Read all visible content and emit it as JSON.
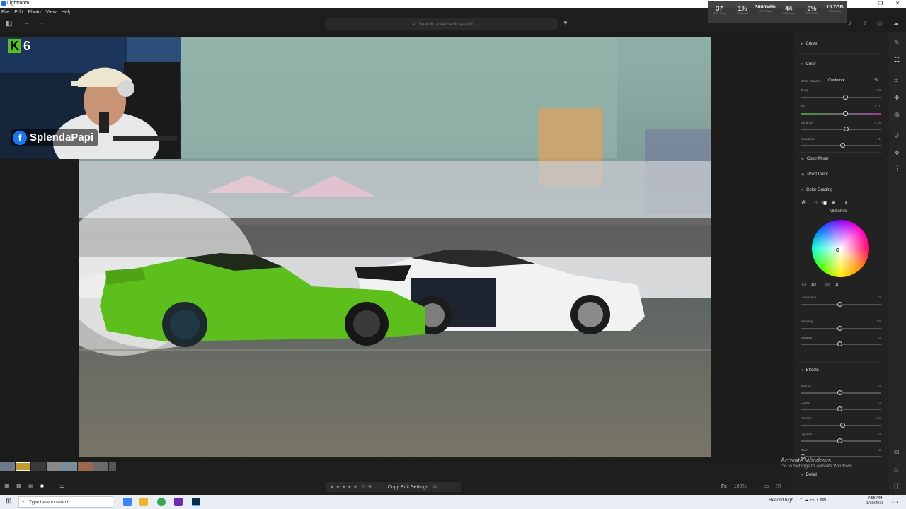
{
  "window": {
    "title": "Lightroom",
    "controls": [
      "—",
      "❐",
      "✕"
    ]
  },
  "menu": [
    "File",
    "Edit",
    "Photo",
    "View",
    "Help"
  ],
  "stats": [
    {
      "value": "37",
      "label": "CPU Temp"
    },
    {
      "value": "1%",
      "label": "GPU Load"
    },
    {
      "value": "3600MHz",
      "label": "CPU Clock"
    },
    {
      "value": "44",
      "label": "GPU Temp"
    },
    {
      "value": "0%",
      "label": "GPU Load"
    },
    {
      "value": "10.7GB",
      "label": "RAM Used"
    }
  ],
  "search": {
    "placeholder": "Search stream edit sesh#1"
  },
  "overlay": {
    "badge_letter": "K",
    "badge_count": "6",
    "streamer": "SplendaPapi"
  },
  "panel": {
    "curve": "Curve",
    "color": "Color",
    "white_balance_label": "White Balance",
    "white_balance_value": "Custom",
    "sliders_color": [
      {
        "label": "Temp",
        "value": "+ 18"
      },
      {
        "label": "Tint",
        "value": "+ 11"
      },
      {
        "label": "Vibrance",
        "value": "+ 18"
      },
      {
        "label": "Saturation",
        "value": "+ 1"
      }
    ],
    "color_mixer": "Color Mixer",
    "point_color": "Point Color",
    "color_grading": "Color Grading",
    "midtones": "Midtones",
    "hue_label": "Hue",
    "hue_value": "217",
    "sat_label": "Sat",
    "sat_value": "11",
    "sliders_grading": [
      {
        "label": "Luminance",
        "value": "0"
      },
      {
        "label": "Blending",
        "value": "50"
      },
      {
        "label": "Balance",
        "value": "0"
      }
    ],
    "effects": "Effects",
    "sliders_effects": [
      {
        "label": "Texture",
        "value": "0"
      },
      {
        "label": "Clarity",
        "value": "0"
      },
      {
        "label": "Dehaze",
        "value": "+ 5"
      },
      {
        "label": "Vignette",
        "value": "0"
      },
      {
        "label": "Grain",
        "value": "0"
      }
    ],
    "detail": "Detail"
  },
  "activate": {
    "line1": "Activate Windows",
    "line2": "Go to Settings to activate Windows."
  },
  "bottombar": {
    "copy_edit": "Copy Edit Settings",
    "fit": "Fit",
    "zoom": "100%"
  },
  "taskbar": {
    "search": "Type here to search",
    "tray": "Record high",
    "time": "7:55 PM",
    "date": "3/20/2026"
  },
  "colors": {
    "accent": "#1473e6",
    "panel_bg": "#222222",
    "car_green": "#5cbf1c"
  }
}
